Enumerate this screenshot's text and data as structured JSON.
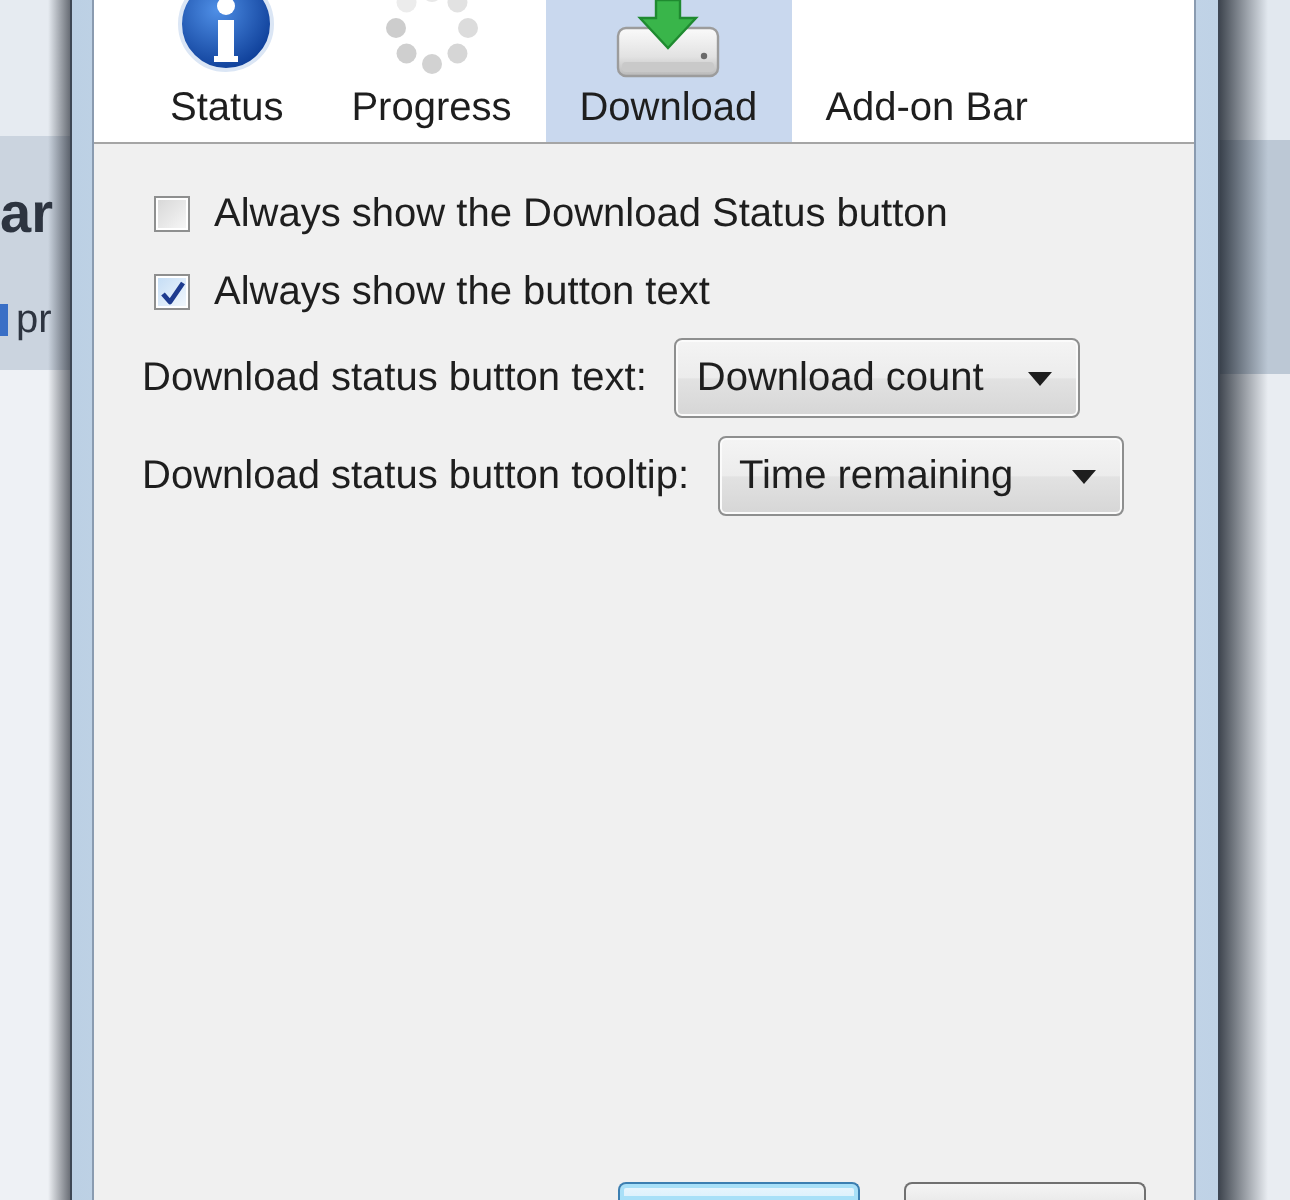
{
  "background": {
    "title_fragment": "ar",
    "item_fragment": "pr"
  },
  "dialog": {
    "tabs": [
      {
        "label": "Status",
        "selected": false
      },
      {
        "label": "Progress",
        "selected": false
      },
      {
        "label": "Download",
        "selected": true
      },
      {
        "label": "Add-on Bar",
        "selected": false
      }
    ],
    "checkboxes": [
      {
        "label": "Always show the Download Status button",
        "checked": false
      },
      {
        "label": "Always show the button text",
        "checked": true
      }
    ],
    "dropdowns": [
      {
        "label": "Download status button text:",
        "value": "Download count"
      },
      {
        "label": "Download status button tooltip:",
        "value": "Time remaining"
      }
    ],
    "buttons": [
      {
        "focused": true
      },
      {
        "focused": false
      }
    ]
  }
}
